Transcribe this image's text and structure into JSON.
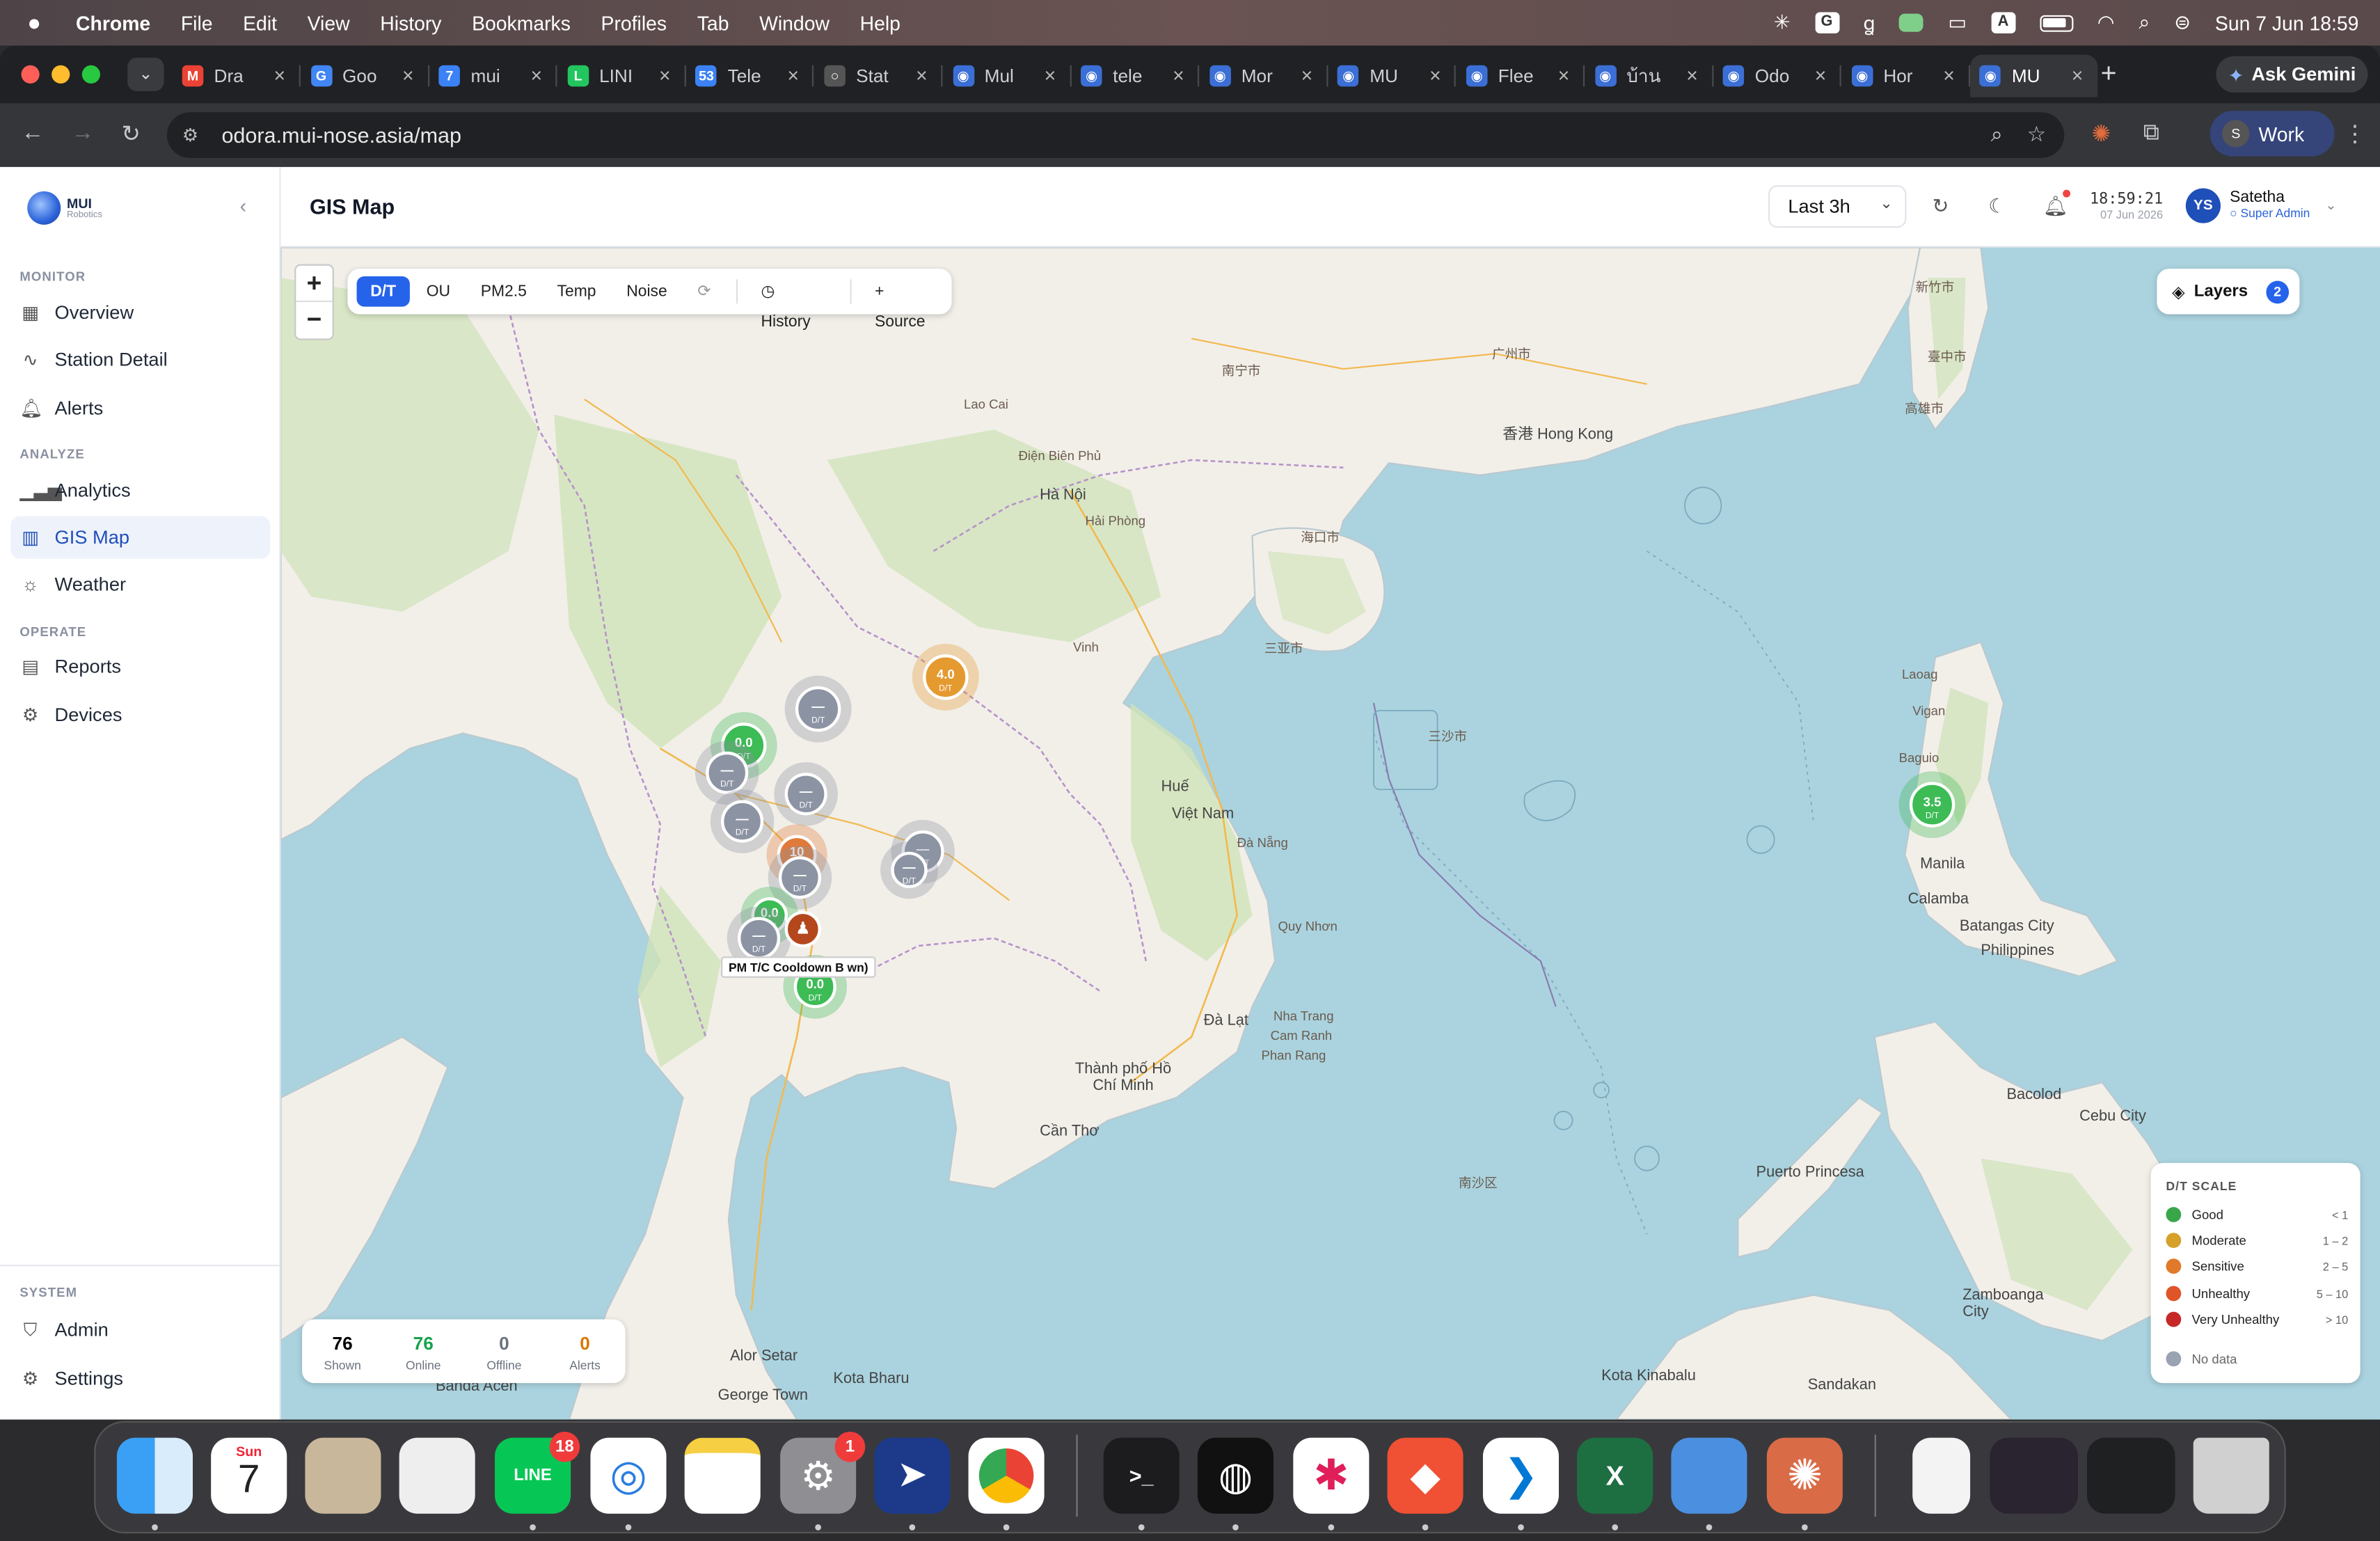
{
  "menubar": {
    "app": "Chrome",
    "items": [
      "File",
      "Edit",
      "View",
      "History",
      "Bookmarks",
      "Profiles",
      "Tab",
      "Window",
      "Help"
    ],
    "datetime": "Sun 7 Jun  18:59"
  },
  "browser": {
    "tabs": [
      {
        "title": "Dra",
        "color": "#ea4335",
        "glyph": "M"
      },
      {
        "title": "Goo",
        "color": "#4285f4",
        "glyph": "G"
      },
      {
        "title": "mui",
        "color": "#3b82f6",
        "glyph": "7"
      },
      {
        "title": "LINI",
        "color": "#22c55e",
        "glyph": "L"
      },
      {
        "title": "Tele",
        "color": "#3b82f6",
        "glyph": "53"
      },
      {
        "title": "Stat",
        "color": "#555555",
        "glyph": "○"
      },
      {
        "title": "Mul",
        "color": "#3b6fd6",
        "glyph": "◉"
      },
      {
        "title": "tele",
        "color": "#3b6fd6",
        "glyph": "◉"
      },
      {
        "title": "Mor",
        "color": "#3b6fd6",
        "glyph": "◉"
      },
      {
        "title": "MU",
        "color": "#3b6fd6",
        "glyph": "◉"
      },
      {
        "title": "Flee",
        "color": "#3b6fd6",
        "glyph": "◉"
      },
      {
        "title": "บ้าน",
        "color": "#3b6fd6",
        "glyph": "◉"
      },
      {
        "title": "Odo",
        "color": "#3b6fd6",
        "glyph": "◉"
      },
      {
        "title": "Hor",
        "color": "#3b6fd6",
        "glyph": "◉"
      },
      {
        "title": "MU",
        "color": "#3b6fd6",
        "glyph": "◉",
        "active": true
      }
    ],
    "ask_gemini": "Ask Gemini",
    "url": "odora.mui-nose.asia/map",
    "profile_initial": "S",
    "profile_label": "Work"
  },
  "sidebar": {
    "logo_title": "MUI",
    "logo_sub": "Robotics",
    "sections": {
      "monitor": "MONITOR",
      "analyze": "ANALYZE",
      "operate": "OPERATE",
      "system": "SYSTEM"
    },
    "items": {
      "overview": "Overview",
      "station_detail": "Station Detail",
      "alerts": "Alerts",
      "analytics": "Analytics",
      "gis_map": "GIS Map",
      "weather": "Weather",
      "reports": "Reports",
      "devices": "Devices",
      "admin": "Admin",
      "settings": "Settings"
    }
  },
  "header": {
    "title": "GIS Map",
    "range": "Last 3h",
    "time": "18:59:21",
    "date": "07 Jun 2026",
    "user_initials": "YS",
    "user_name": "Satetha",
    "user_role": "Super Admin"
  },
  "map_toolbar": {
    "pills": [
      "D/T",
      "OU",
      "PM2.5",
      "Temp",
      "Noise"
    ],
    "active": "D/T",
    "history": "History",
    "source": "+ Source"
  },
  "layers": {
    "label": "Layers",
    "count": "2"
  },
  "markers": {
    "m1": {
      "value": "4.0",
      "unit": "D/T",
      "color": "#e59a2f"
    },
    "m2": {
      "value": "0.0",
      "unit": "D/T",
      "color": "#3dbb55"
    },
    "m3": {
      "value": "3.5",
      "unit": "D/T",
      "color": "#3dbb55"
    },
    "m4": {
      "value": "0.0",
      "unit": "D/T",
      "color": "#3dbb55"
    },
    "m5": {
      "value": "10",
      "unit": "D/T",
      "color": "#e07a3a"
    },
    "none": {
      "value": "—",
      "unit": "D/T",
      "color": "#8c93a3"
    }
  },
  "tooltip": "PM  T/C Cooldown B  wn)",
  "stats": [
    {
      "value": "76",
      "label": "Shown",
      "color": "#111827"
    },
    {
      "value": "76",
      "label": "Online",
      "color": "#16a34a"
    },
    {
      "value": "0",
      "label": "Offline",
      "color": "#6b7280"
    },
    {
      "value": "0",
      "label": "Alerts",
      "color": "#d97706"
    }
  ],
  "legend": {
    "title": "D/T SCALE",
    "rows": [
      {
        "label": "Good",
        "range": "< 1",
        "color": "#3aa64a"
      },
      {
        "label": "Moderate",
        "range": "1 – 2",
        "color": "#d6a02a"
      },
      {
        "label": "Sensitive",
        "range": "2 – 5",
        "color": "#e07a2a"
      },
      {
        "label": "Unhealthy",
        "range": "5 – 10",
        "color": "#e0542a"
      },
      {
        "label": "Very Unhealthy",
        "range": "> 10",
        "color": "#c62828"
      }
    ],
    "no_data": "No data"
  },
  "map_labels": {
    "hanoi": "Hà Nội",
    "haiphong": "Hải Phòng",
    "hue": "Huế",
    "vietnam": "Việt Nam",
    "danang": "Đà Nẵng",
    "hcm": "Thành phố Hồ Chí Minh",
    "cantho": "Cần Thơ",
    "nhatrang": "Nha Trang",
    "camranh": "Cam Ranh",
    "phanrang": "Phan Rang",
    "dalat": "Đà Lạt",
    "quynhon": "Quy Nhơn",
    "hongkong": "香港 Hong Kong",
    "manila": "Manila",
    "philippines": "Philippines",
    "batangas": "Batangas City",
    "puerto": "Puerto Princesa",
    "zamboanga": "Zamboanga City",
    "cebu": "Cebu City",
    "bacolod": "Bacolod",
    "kotakinabalu": "Kota Kinabalu",
    "sandakan": "Sandakan",
    "kotabharu": "Kota Bharu",
    "georgetown": "George Town",
    "alorsetar": "Alor Setar",
    "bandaaceh": "Banda Aceh",
    "baguio": "Baguio",
    "vigan": "Vigan",
    "laoag": "Laoag",
    "calamba": "Calamba",
    "taichung": "臺中市",
    "kaohsiung": "高雄市",
    "taipei": "新竹市",
    "guangzhou": "广州市",
    "haikou": "海口市",
    "sanya": "三亚市",
    "nanning": "南宁市",
    "vinh": "Vinh",
    "laocai": "Lao Cai",
    "dienbien": "Điện Biên Phủ",
    "sansha": "三沙市",
    "nansha": "南沙区"
  }
}
